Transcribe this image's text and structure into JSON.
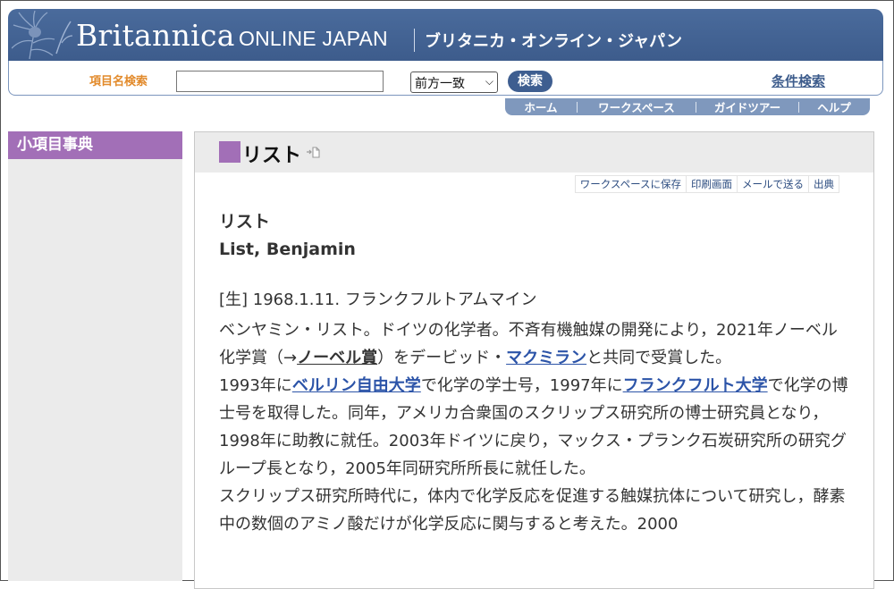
{
  "header": {
    "brand": "Britannica",
    "brand_sub": "ONLINE JAPAN",
    "brand_ja": "ブリタニカ・オンライン・ジャパン",
    "logo_icon": "thistle-logo-icon"
  },
  "search": {
    "label": "項目名検索",
    "value": "",
    "placeholder": "",
    "match_mode": "前方一致",
    "button": "検索",
    "advanced": "条件検索"
  },
  "nav": {
    "home": "ホーム",
    "workspace": "ワークスペース",
    "guide": "ガイドツアー",
    "help": "ヘルプ"
  },
  "sidebar": {
    "title": "小項目事典"
  },
  "article": {
    "title": "リスト",
    "tools": {
      "save": "ワークスペースに保存",
      "print": "印刷画面",
      "mail": "メールで送る",
      "source": "出典"
    },
    "headword": "リスト",
    "headword_en": "List, Benjamin",
    "birth": "[生] 1968.1.11. フランクフルトアムマイン",
    "p1": {
      "a": "ベンヤミン・リスト。ドイツの化学者。不斉有機触媒の開発により，2021年ノーベル化学賞（→",
      "link1": "ノーベル賞",
      "b": "）をデービッド・",
      "link2": "マクミラン",
      "c": "と共同で受賞した。"
    },
    "p2": {
      "a": "1993年に",
      "link1": "ベルリン自由大学",
      "b": "で化学の学士号，1997年に",
      "link2": "フランクフルト大学",
      "c": "で化学の博士号を取得した。同年，アメリカ合衆国のスクリップス研究所の博士研究員となり，1998年に助教に就任。2003年ドイツに戻り，マックス・プランク石炭研究所の研究グループ長となり，2005年同研究所所長に就任した。"
    },
    "p3": "スクリップス研究所時代に，体内で化学反応を促進する触媒抗体について研究し，酵素中の数個のアミノ酸だけが化学反応に関与すると考えた。2000"
  },
  "colors": {
    "banner": "#3d5c8c",
    "accent_purple": "#a26fb7",
    "link_blue": "#2c54a8",
    "search_label_orange": "#e28a2b"
  }
}
